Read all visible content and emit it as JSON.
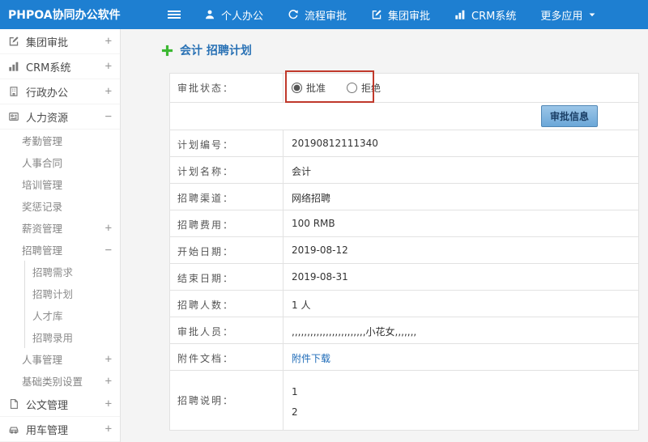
{
  "colors": {
    "topbar": "#1e7fd1",
    "accent": "#2a72b5",
    "link": "#1e6bb8",
    "annotation": "#c0392b",
    "plus_icon": "#3cb832"
  },
  "topbar": {
    "brand": "PHPOA协同办公软件",
    "menu_icon": "hamburger-icon",
    "nav": [
      {
        "label": "个人办公",
        "icon": "person-icon"
      },
      {
        "label": "流程审批",
        "icon": "refresh-icon"
      },
      {
        "label": "集团审批",
        "icon": "edit-icon"
      },
      {
        "label": "CRM系统",
        "icon": "chart-icon"
      },
      {
        "label": "更多应用",
        "icon": "caret-down-icon"
      }
    ]
  },
  "sidebar": {
    "items": [
      {
        "label": "集团审批",
        "icon": "edit-icon",
        "expander": "+",
        "level": 0
      },
      {
        "label": "CRM系统",
        "icon": "chart-icon",
        "expander": "+",
        "level": 0
      },
      {
        "label": "行政办公",
        "icon": "building-icon",
        "expander": "+",
        "level": 0
      },
      {
        "label": "人力资源",
        "icon": "people-icon",
        "expander": "-",
        "level": 0
      },
      {
        "label": "考勤管理",
        "level": 1
      },
      {
        "label": "人事合同",
        "level": 1
      },
      {
        "label": "培训管理",
        "level": 1
      },
      {
        "label": "奖惩记录",
        "level": 1
      },
      {
        "label": "薪资管理",
        "expander": "+",
        "level": 1
      },
      {
        "label": "招聘管理",
        "expander": "-",
        "level": 1
      },
      {
        "label": "招聘需求",
        "level": 2
      },
      {
        "label": "招聘计划",
        "level": 2
      },
      {
        "label": "人才库",
        "level": 2
      },
      {
        "label": "招聘录用",
        "level": 2
      },
      {
        "label": "人事管理",
        "expander": "+",
        "level": 1
      },
      {
        "label": "基础类别设置",
        "expander": "+",
        "level": 1
      },
      {
        "label": "公文管理",
        "icon": "document-icon",
        "expander": "+",
        "level": 0
      },
      {
        "label": "用车管理",
        "icon": "car-icon",
        "expander": "+",
        "level": 0
      }
    ]
  },
  "main": {
    "title": "会计 招聘计划",
    "title_icon": "add-icon",
    "status_row": {
      "label": "审批状态：",
      "options": [
        {
          "label": "批准",
          "selected": true
        },
        {
          "label": "拒绝",
          "selected": false
        }
      ]
    },
    "approve_button_label": "审批信息",
    "rows": [
      {
        "label": "计划编号：",
        "value": "20190812111340"
      },
      {
        "label": "计划名称：",
        "value": "会计"
      },
      {
        "label": "招聘渠道：",
        "value": "网络招聘"
      },
      {
        "label": "招聘费用：",
        "value": "100 RMB"
      },
      {
        "label": "开始日期：",
        "value": "2019-08-12"
      },
      {
        "label": "结束日期：",
        "value": "2019-08-31"
      },
      {
        "label": "招聘人数：",
        "value": "1 人"
      },
      {
        "label": "审批人员：",
        "value": ",,,,,,,,,,,,,,,,,,,,,,,,小花女,,,,,,,"
      },
      {
        "label": "附件文档：",
        "value": "附件下载",
        "link": true
      },
      {
        "label": "招聘说明：",
        "lines": [
          "1",
          "2"
        ]
      }
    ]
  }
}
